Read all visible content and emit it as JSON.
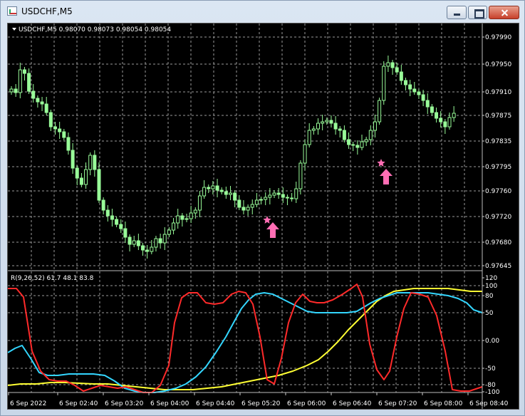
{
  "window": {
    "title": "USDCHF,M5"
  },
  "main_chart": {
    "header": "USDCHF,M5  0.98070 0.98073 0.98054 0.98054",
    "price_levels": [
      "0.97990",
      "0.97950",
      "0.97910",
      "0.97875",
      "0.97835",
      "0.97795",
      "0.97760",
      "0.97720",
      "0.97680",
      "0.97645"
    ]
  },
  "indicator": {
    "header": "R(9,26,52) 61.7 48.1 83.8",
    "levels": [
      "120",
      "100",
      "80",
      "50",
      "0.00",
      "-50",
      "-80",
      "-100"
    ],
    "colors": {
      "fast": "#ff2a2a",
      "medium": "#33d6ff",
      "slow": "#ffff33"
    }
  },
  "time_labels": [
    "6 Sep 2022",
    "6 Sep 02:40",
    "6 Sep 03:20",
    "6 Sep 04:00",
    "6 Sep 04:40",
    "6 Sep 05:20",
    "6 Sep 06:00",
    "6 Sep 06:40",
    "6 Sep 07:20",
    "6 Sep 08:00",
    "6 Sep 08:40"
  ],
  "colors": {
    "background": "#000000",
    "grid": "#9a9a9a",
    "candle": "#98fb98",
    "signal": "#ff6eb4"
  }
}
